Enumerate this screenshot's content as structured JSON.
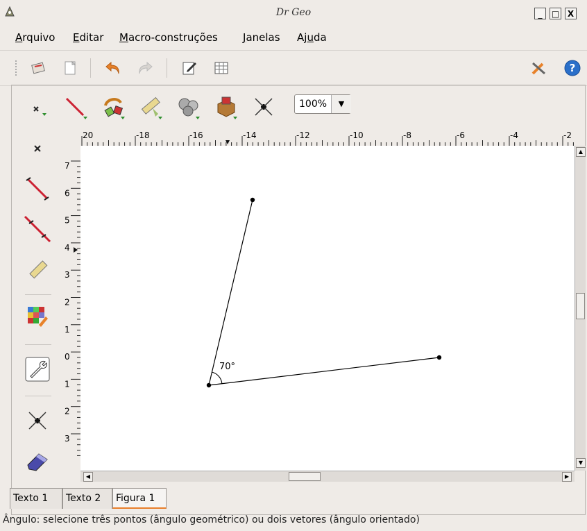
{
  "window": {
    "title": "Dr Geo",
    "buttons": [
      "_",
      "□",
      "X"
    ]
  },
  "menu": {
    "items": [
      {
        "label": "Arquivo"
      },
      {
        "label": "Editar"
      },
      {
        "label": "Macro-construções"
      },
      {
        "label": "Janelas"
      },
      {
        "label": "Ajuda"
      }
    ]
  },
  "toolbar": {
    "icons": [
      "document-icon",
      "new-icon",
      "undo-icon",
      "redo-icon",
      "edit-icon",
      "grid-icon",
      "tools-icon",
      "help-icon"
    ],
    "help_glyph": "?"
  },
  "tools": {
    "zoom": "100%",
    "icons": [
      "point-tool-icon",
      "line-tool-icon",
      "transform-tool-icon",
      "measure-tool-icon",
      "macro-tool-icon",
      "other-tool-icon",
      "move-tool-icon"
    ]
  },
  "left_tools": {
    "icons": [
      "point-icon",
      "segment-icon",
      "line-icon",
      "ruler-icon",
      "color-palette-icon",
      "wrench-icon",
      "move-icon",
      "eraser-icon"
    ]
  },
  "rulers": {
    "h_labels": [
      "20",
      "-18",
      "-16",
      "-14",
      "-12",
      "-10",
      "-8",
      "-6",
      "-4",
      "-2"
    ],
    "v_labels": [
      "7",
      "6",
      "5",
      "4",
      "3",
      "2",
      "1",
      "0",
      "1",
      "2",
      "3"
    ]
  },
  "figure": {
    "angle_label": "70°",
    "vertex": [
      -15.5,
      -1.0
    ],
    "point_a": [
      -13.2,
      5.8
    ],
    "point_b": [
      -7.9,
      0.0
    ]
  },
  "tabs": [
    {
      "label": "Texto 1",
      "active": false
    },
    {
      "label": "Texto 2",
      "active": false
    },
    {
      "label": "Figura 1",
      "active": true
    }
  ],
  "status": {
    "text": "Ângulo: selecione três pontos (ângulo geométrico) ou dois vetores (ângulo orientado)"
  },
  "colors": {
    "accent": "#e87e29",
    "help": "#2a6fc9",
    "undo": "#e8822a"
  }
}
